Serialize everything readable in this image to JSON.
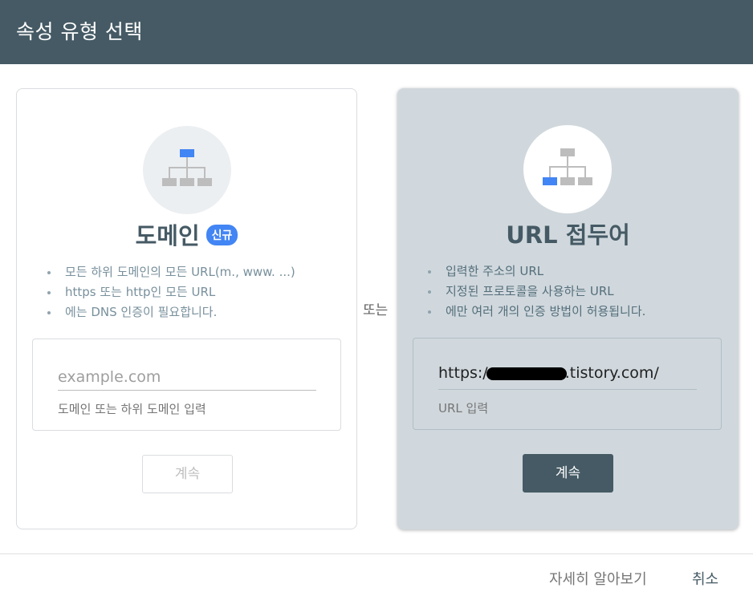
{
  "header": {
    "title": "속성 유형 선택"
  },
  "domain_card": {
    "title": "도메인",
    "badge": "신규",
    "bullets": [
      "모든 하위 도메인의 모든 URL(m., www. ...)",
      "https 또는 http인 모든 URL",
      "에는 DNS 인증이 필요합니다."
    ],
    "input": {
      "value": "",
      "placeholder": "example.com",
      "help": "도메인 또는 하위 도메인 입력"
    },
    "continue_label": "계속"
  },
  "or_label": "또는",
  "url_card": {
    "title": "URL 접두어",
    "bullets": [
      "입력한 주소의 URL",
      "지정된 프로토콜을 사용하는 URL",
      "에만 여러 개의 인증 방법이 허용됩니다."
    ],
    "input": {
      "value_prefix": "https:/",
      "value_suffix": ".tistory.com/",
      "help": "URL 입력"
    },
    "continue_label": "계속"
  },
  "footer": {
    "learn_more": "자세히 알아보기",
    "cancel": "취소"
  },
  "colors": {
    "header": "#455a64",
    "accent_blue": "#4285f4",
    "selected_card": "#d0d8dd",
    "primary_button": "#455a64"
  },
  "icons": {
    "domain_card": "sitemap-icon",
    "url_card": "sitemap-icon"
  }
}
